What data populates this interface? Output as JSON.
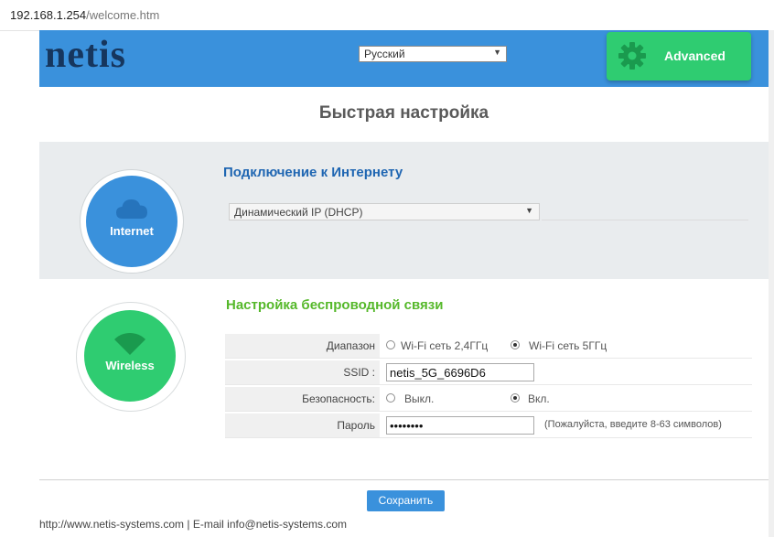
{
  "browser": {
    "host": "192.168.1.254",
    "path": "/welcome.htm"
  },
  "header": {
    "logo": "netis",
    "language": "Русский",
    "advanced_label": "Advanced",
    "advanced_icon": "gear-icon"
  },
  "title": "Быстрая настройка",
  "internet": {
    "badge": "Internet",
    "badge_icon": "cloud-icon",
    "heading": "Подключение к Интернету",
    "connection_type": "Динамический IP (DHCP)"
  },
  "wireless": {
    "badge": "Wireless",
    "badge_icon": "wifi-icon",
    "heading": "Настройка беспроводной связи",
    "band_label": "Диапазон",
    "band_options": [
      "Wi-Fi сеть 2,4ГГц",
      "Wi-Fi сеть 5ГГц"
    ],
    "band_selected": "Wi-Fi сеть 5ГГц",
    "ssid_label": "SSID :",
    "ssid_value": "netis_5G_6696D6",
    "security_label": "Безопасность:",
    "security_options": [
      "Выкл.",
      "Вкл."
    ],
    "security_selected": "Вкл.",
    "password_label": "Пароль",
    "password_masked": "••••••••",
    "password_hint": "(Пожалуйста, введите 8-63 символов)"
  },
  "save_label": "Сохранить",
  "footer": "http://www.netis-systems.com | E-mail info@netis-systems.com",
  "colors": {
    "brand_blue": "#3a91dc",
    "brand_green": "#2fcc71",
    "logo_navy": "#16365e"
  }
}
